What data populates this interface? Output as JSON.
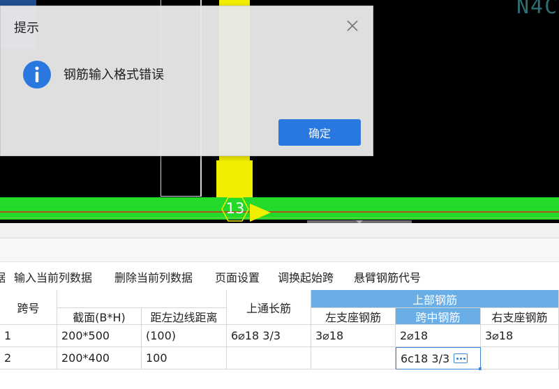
{
  "canvas": {
    "corner_text": "N4C",
    "axis_label": "13"
  },
  "dialog": {
    "title": "提示",
    "message": "钢筋输入格式错误",
    "ok_label": "确定"
  },
  "toolbar": {
    "cut_item": "据",
    "items": [
      "输入当前列数据",
      "删除当前列数据",
      "页面设置",
      "调换起始跨",
      "悬臂钢筋代号"
    ]
  },
  "grid": {
    "headers": {
      "span_no": "跨号",
      "section": "截面(B*H)",
      "dist_left": "距左边线距离",
      "top_through": "上通长筋",
      "top_rebar_group": "上部钢筋",
      "left_support": "左支座钢筋",
      "mid_span": "跨中钢筋",
      "right_support": "右支座钢筋"
    },
    "rows": [
      {
        "span_no": "1",
        "section": "200*500",
        "dist_left": "(100)",
        "top_through": "6⌀18 3/3",
        "left_support": "3⌀18",
        "mid_span": "2⌀18",
        "right_support": "3⌀18"
      },
      {
        "span_no": "2",
        "section": "200*400",
        "dist_left": "100",
        "top_through": "",
        "left_support": "",
        "mid_span": "6c18 3/3",
        "right_support": ""
      }
    ]
  },
  "colors": {
    "accent": "#2b7de9",
    "header_selected": "#6aaee8",
    "beam_green": "#23d92a",
    "column_yellow": "#f2ee00"
  },
  "icons": {
    "close": "close-icon",
    "info": "info-icon",
    "ellipsis": "ellipsis-icon"
  }
}
